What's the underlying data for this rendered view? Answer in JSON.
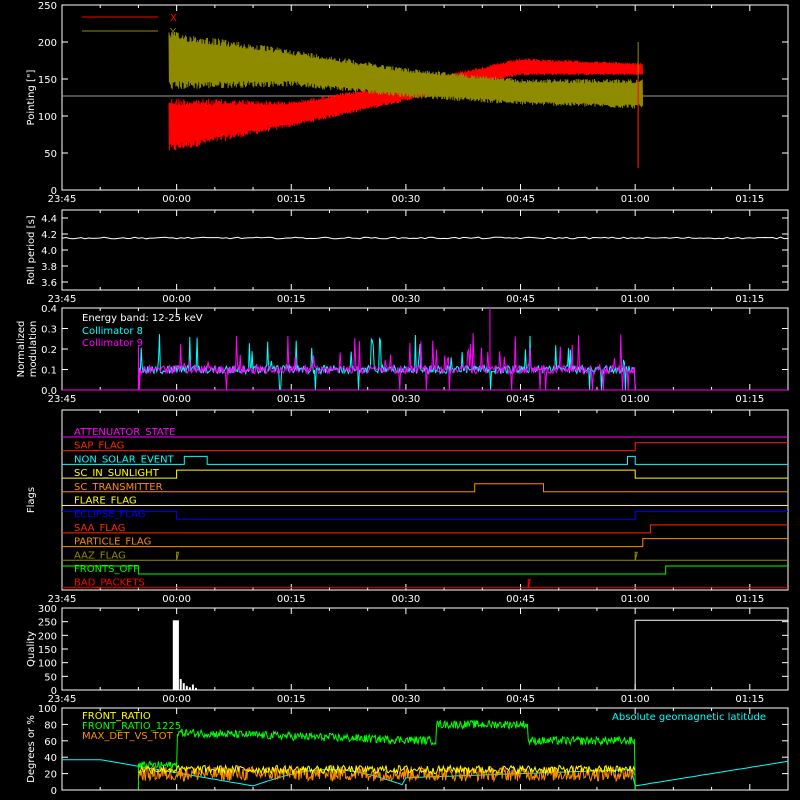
{
  "chart_data": [
    {
      "type": "line",
      "panel": "pointing",
      "ylabel": "Pointing [\"]",
      "ylim": [
        0,
        250
      ],
      "yticks": [
        0,
        50,
        100,
        150,
        200,
        250
      ],
      "xticks": [
        "23:45",
        "00:00",
        "00:15",
        "00:30",
        "00:45",
        "01:00",
        "01:15"
      ],
      "series": [
        {
          "name": "X",
          "color": "#ff0000",
          "envelope_x": [
            "23:59",
            "00:15",
            "00:30",
            "00:45",
            "01:00"
          ],
          "envelope_upper": [
            125,
            120,
            145,
            178,
            172
          ],
          "envelope_lower": [
            50,
            85,
            120,
            155,
            155
          ]
        },
        {
          "name": "Y",
          "color": "#8f8b00",
          "envelope_x": [
            "23:59",
            "00:15",
            "00:30",
            "00:45",
            "01:00"
          ],
          "envelope_upper": [
            215,
            190,
            165,
            150,
            150
          ],
          "envelope_lower": [
            135,
            140,
            125,
            115,
            110
          ]
        }
      ],
      "baseline": 127
    },
    {
      "type": "line",
      "panel": "roll",
      "ylabel": "Roll period [s]",
      "ylim": [
        3.5,
        4.5
      ],
      "yticks": [
        3.6,
        3.8,
        4.0,
        4.2,
        4.4
      ],
      "series": [
        {
          "name": "",
          "color": "#ffffff",
          "value": 4.15
        }
      ]
    },
    {
      "type": "line",
      "panel": "modulation",
      "ylabel": "Normalized modulation",
      "ylim": [
        0,
        0.4
      ],
      "yticks": [
        0,
        0.1,
        0.2,
        0.3,
        0.4
      ],
      "annotation": "Energy band: 12-25 keV",
      "series": [
        {
          "name": "Collimator 8",
          "color": "#00ffff",
          "range": [
            "23:55",
            "01:00"
          ],
          "mean": 0.1
        },
        {
          "name": "Collimator 9",
          "color": "#ff00ff",
          "range": [
            "23:55",
            "01:00"
          ],
          "mean": 0.1
        }
      ]
    },
    {
      "type": "line",
      "panel": "flags",
      "ylabel": "Flags",
      "flags": [
        {
          "name": "ATTENUATOR_STATE",
          "color": "#ff00ff",
          "segments": [
            [
              "23:45",
              "01:20",
              0
            ]
          ]
        },
        {
          "name": "SAP_FLAG",
          "color": "#ff2a00",
          "segments": [
            [
              "23:45",
              "01:00",
              0
            ],
            [
              "01:00",
              "01:20",
              1
            ]
          ]
        },
        {
          "name": "NON_SOLAR_EVENT",
          "color": "#00ffff",
          "segments": [
            [
              "23:45",
              "00:01",
              0
            ],
            [
              "00:01",
              "00:04",
              1
            ],
            [
              "00:04",
              "00:59",
              0
            ],
            [
              "00:59",
              "01:00",
              1
            ],
            [
              "01:00",
              "01:20",
              0
            ]
          ]
        },
        {
          "name": "SC_IN_SUNLIGHT",
          "color": "#ffff00",
          "segments": [
            [
              "23:45",
              "00:00",
              0
            ],
            [
              "00:00",
              "01:00",
              1
            ],
            [
              "01:00",
              "01:20",
              0
            ]
          ]
        },
        {
          "name": "SC_TRANSMITTER",
          "color": "#ff8c00",
          "segments": [
            [
              "23:45",
              "00:39",
              0
            ],
            [
              "00:39",
              "00:48",
              1
            ],
            [
              "00:48",
              "01:20",
              0
            ]
          ]
        },
        {
          "name": "FLARE_FLAG",
          "color": "#ffff00",
          "segments": [
            [
              "23:45",
              "01:20",
              0
            ]
          ]
        },
        {
          "name": "ECLIPSE_FLAG",
          "color": "#0000ff",
          "segments": [
            [
              "23:45",
              "00:00",
              1
            ],
            [
              "00:00",
              "01:00",
              0
            ],
            [
              "01:00",
              "01:20",
              1
            ]
          ]
        },
        {
          "name": "SAA_FLAG",
          "color": "#ff2a00",
          "segments": [
            [
              "23:45",
              "01:02",
              0
            ],
            [
              "01:02",
              "01:20",
              1
            ]
          ]
        },
        {
          "name": "PARTICLE_FLAG",
          "color": "#ff8c00",
          "segments": [
            [
              "23:45",
              "01:01",
              0
            ],
            [
              "01:01",
              "01:20",
              1
            ]
          ]
        },
        {
          "name": "AAZ_FLAG",
          "color": "#8f8b00",
          "segments": [
            [
              "23:45",
              "00:00",
              0
            ],
            [
              "00:00",
              "00:00",
              1
            ],
            [
              "00:00",
              "01:00",
              0
            ],
            [
              "01:00",
              "01:00",
              1
            ],
            [
              "01:00",
              "01:20",
              0
            ]
          ]
        },
        {
          "name": "FRONTS_OFF",
          "color": "#00ff00",
          "segments": [
            [
              "23:45",
              "23:55",
              1
            ],
            [
              "23:55",
              "01:04",
              0
            ],
            [
              "01:04",
              "01:20",
              1
            ]
          ]
        },
        {
          "name": "BAD_PACKETS",
          "color": "#ff0000",
          "segments": [
            [
              "23:45",
              "00:46",
              0
            ],
            [
              "00:46",
              "00:46",
              1
            ],
            [
              "00:46",
              "01:20",
              0
            ]
          ]
        }
      ]
    },
    {
      "type": "bar",
      "panel": "quality",
      "ylabel": "Quality",
      "ylim": [
        0,
        300
      ],
      "yticks": [
        0,
        50,
        100,
        150,
        200,
        250,
        300
      ],
      "xticks": [
        "23:45",
        "00:00",
        "00:15",
        "00:30",
        "00:45",
        "01:00",
        "01:15"
      ],
      "segments": [
        [
          "23:45",
          "00:00",
          255
        ],
        [
          "00:00",
          "00:02",
          40
        ],
        [
          "00:02",
          "01:00",
          0
        ],
        [
          "01:00",
          "01:20",
          255
        ]
      ]
    },
    {
      "type": "line",
      "panel": "front_ratio",
      "ylabel": "Degrees or %",
      "ylim": [
        0,
        100
      ],
      "yticks": [
        0,
        20,
        40,
        60,
        80,
        100
      ],
      "annotation": "Absolute geomagnetic latitude",
      "series": [
        {
          "name": "FRONT_RATIO",
          "color": "#ffff00"
        },
        {
          "name": "FRONT_RATIO_1225",
          "color": "#00ff00"
        },
        {
          "name": "MAX_DET_VS_TOT",
          "color": "#ff8c00"
        },
        {
          "name": "",
          "color": "#00ffff"
        }
      ]
    }
  ]
}
